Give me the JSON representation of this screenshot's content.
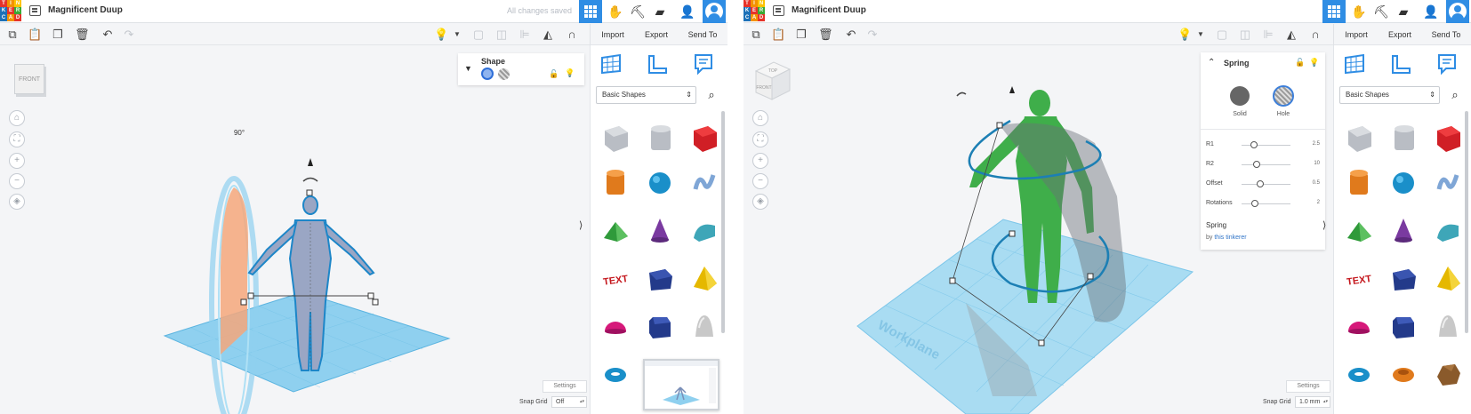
{
  "left": {
    "app": {
      "title": "Magnificent Duup",
      "save_status": "All changes saved"
    },
    "toolbar": {
      "import": "Import",
      "export": "Export",
      "send_to": "Send To"
    },
    "viewcube": {
      "label": "FRONT"
    },
    "scene": {
      "angle_label": "90°"
    },
    "shape_panel": {
      "title": "Shape"
    },
    "sidebar": {
      "library": "Basic Shapes"
    },
    "footer": {
      "settings": "Settings",
      "snap_label": "Snap Grid",
      "snap_value": "Off"
    }
  },
  "right": {
    "app": {
      "title": "Magnificent Duup"
    },
    "toolbar": {
      "import": "Import",
      "export": "Export",
      "send_to": "Send To"
    },
    "viewcube": {
      "top": "TOP",
      "front": "FRONT"
    },
    "scene": {
      "workplane": "Workplane"
    },
    "inspector": {
      "title": "Spring",
      "solid": "Solid",
      "hole": "Hole",
      "params": [
        {
          "name": "R1",
          "value": "2.5",
          "knob": 0.25
        },
        {
          "name": "R2",
          "value": "10",
          "knob": 0.3
        },
        {
          "name": "Offset",
          "value": "0.5",
          "knob": 0.38
        },
        {
          "name": "Rotations",
          "value": "2",
          "knob": 0.28
        }
      ],
      "shape_name": "Spring",
      "by": "by",
      "author": "this tinkerer"
    },
    "sidebar": {
      "library": "Basic Shapes"
    },
    "footer": {
      "settings": "Settings",
      "snap_label": "Snap Grid",
      "snap_value": "1.0 mm"
    }
  },
  "colors": {
    "accent": "#2f8de4",
    "workplane": "#8fd0ef",
    "figure_selected": "#9aa6c4",
    "figure_green": "#3fae4a"
  },
  "logo_letters": [
    "T",
    "I",
    "N",
    "K",
    "E",
    "R",
    "C",
    "A",
    "D"
  ],
  "logo_colors": [
    "#e6332a",
    "#f39200",
    "#fdc300",
    "#1d71b8",
    "#e6332a",
    "#3aaa35",
    "#1d71b8",
    "#f39200",
    "#e6332a"
  ]
}
